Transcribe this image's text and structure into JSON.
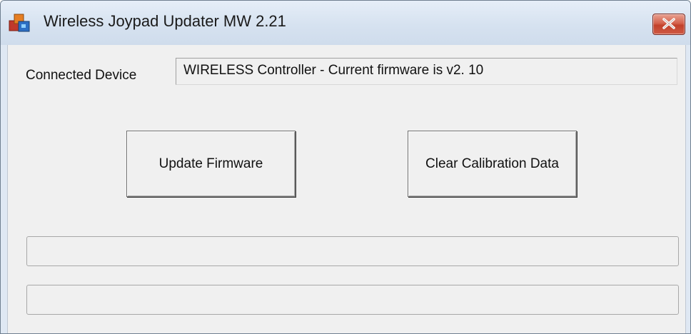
{
  "window": {
    "title": "Wireless Joypad Updater MW 2.21",
    "app_icon": "joypad-app-icon",
    "close_icon": "close-icon"
  },
  "device": {
    "label": "Connected Device",
    "value": "WIRELESS Controller - Current firmware is v2. 10"
  },
  "buttons": {
    "update_firmware": "Update Firmware",
    "clear_calibration": "Clear Calibration Data"
  },
  "progress_bars": [
    {
      "value": 0
    },
    {
      "value": 0
    }
  ],
  "colors": {
    "close_button": "#c7432f",
    "window_background": "#f0f0f0",
    "titlebar": "#dfe8f3"
  }
}
